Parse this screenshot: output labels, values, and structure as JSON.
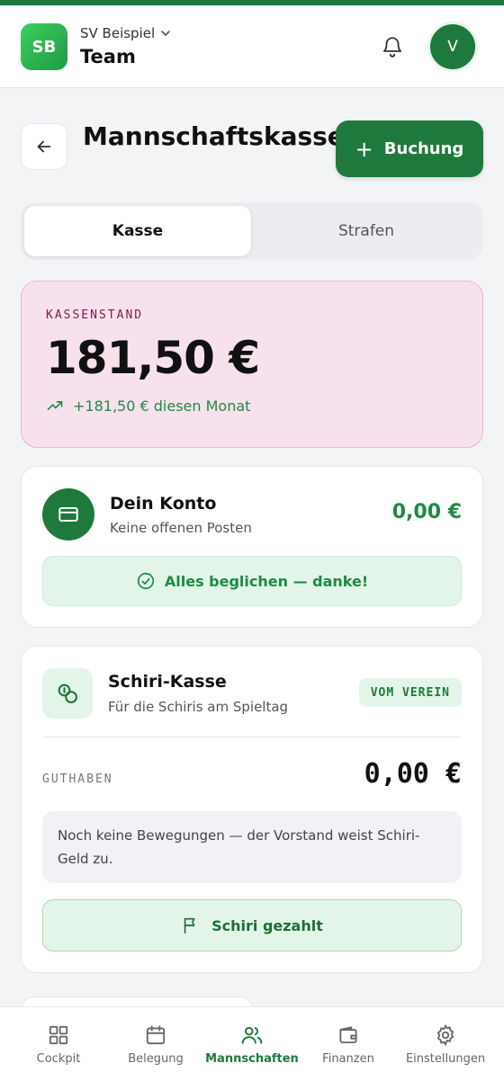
{
  "header": {
    "logo_initials": "SB",
    "org_name": "SV Beispiel",
    "team_name": "Team",
    "avatar_initial": "V"
  },
  "page": {
    "title": "Mannschaftskasse",
    "primary_action": "Buchung"
  },
  "tabs": [
    {
      "label": "Kasse",
      "active": true
    },
    {
      "label": "Strafen",
      "active": false
    }
  ],
  "balance": {
    "label": "KASSENSTAND",
    "value": "181,50 €",
    "trend": "+181,50 € diesen Monat"
  },
  "konto": {
    "title": "Dein Konto",
    "subtitle": "Keine offenen Posten",
    "amount": "0,00 €",
    "status": "Alles beglichen — danke!"
  },
  "schiri": {
    "title": "Schiri-Kasse",
    "subtitle": "Für die Schiris am Spieltag",
    "badge": "VOM VEREIN",
    "guthaben_label": "GUTHABEN",
    "guthaben_value": "0,00 €",
    "empty_text": "Noch keine Bewegungen — der Vorstand weist Schiri-Geld zu.",
    "button": "Schiri gezahlt"
  },
  "nav": [
    {
      "label": "Cockpit",
      "icon": "dashboard-icon",
      "active": false
    },
    {
      "label": "Belegung",
      "icon": "calendar-icon",
      "active": false
    },
    {
      "label": "Mannschaften",
      "icon": "users-icon",
      "active": true
    },
    {
      "label": "Finanzen",
      "icon": "wallet-icon",
      "active": false
    },
    {
      "label": "Einstellungen",
      "icon": "gear-icon",
      "active": false
    }
  ],
  "colors": {
    "brand_green": "#1e7a3c",
    "positive_green": "#1e8a45",
    "balance_card_bg": "#f7e1ec"
  }
}
